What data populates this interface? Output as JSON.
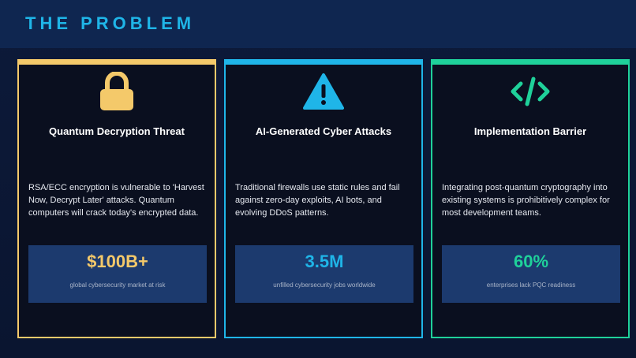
{
  "slide": {
    "title": "THE PROBLEM",
    "colors": {
      "header_bg": "#0f2650",
      "title": "#1fb5e8",
      "yellow": "#f4c96a",
      "blue": "#1fb5e8",
      "green": "#1fd19a",
      "card_bg": "#0a0f1f",
      "stat_bg": "#1c3a6e"
    }
  },
  "cards": [
    {
      "icon": "lock-icon",
      "title": "Quantum Decryption Threat",
      "description": "RSA/ECC encryption is vulnerable to 'Harvest Now, Decrypt Later' attacks. Quantum computers will crack today's encrypted data.",
      "stat_value": "$100B+",
      "stat_label": "global cybersecurity market at risk"
    },
    {
      "icon": "warning-icon",
      "title": "AI-Generated Cyber Attacks",
      "description": "Traditional firewalls use static rules and fail against zero-day exploits, AI bots, and evolving DDoS patterns.",
      "stat_value": "3.5M",
      "stat_label": "unfilled cybersecurity jobs worldwide"
    },
    {
      "icon": "code-icon",
      "title": "Implementation Barrier",
      "description": "Integrating post-quantum cryptography into existing systems is prohibitively complex for most development teams.",
      "stat_value": "60%",
      "stat_label": "enterprises lack PQC readiness"
    }
  ]
}
